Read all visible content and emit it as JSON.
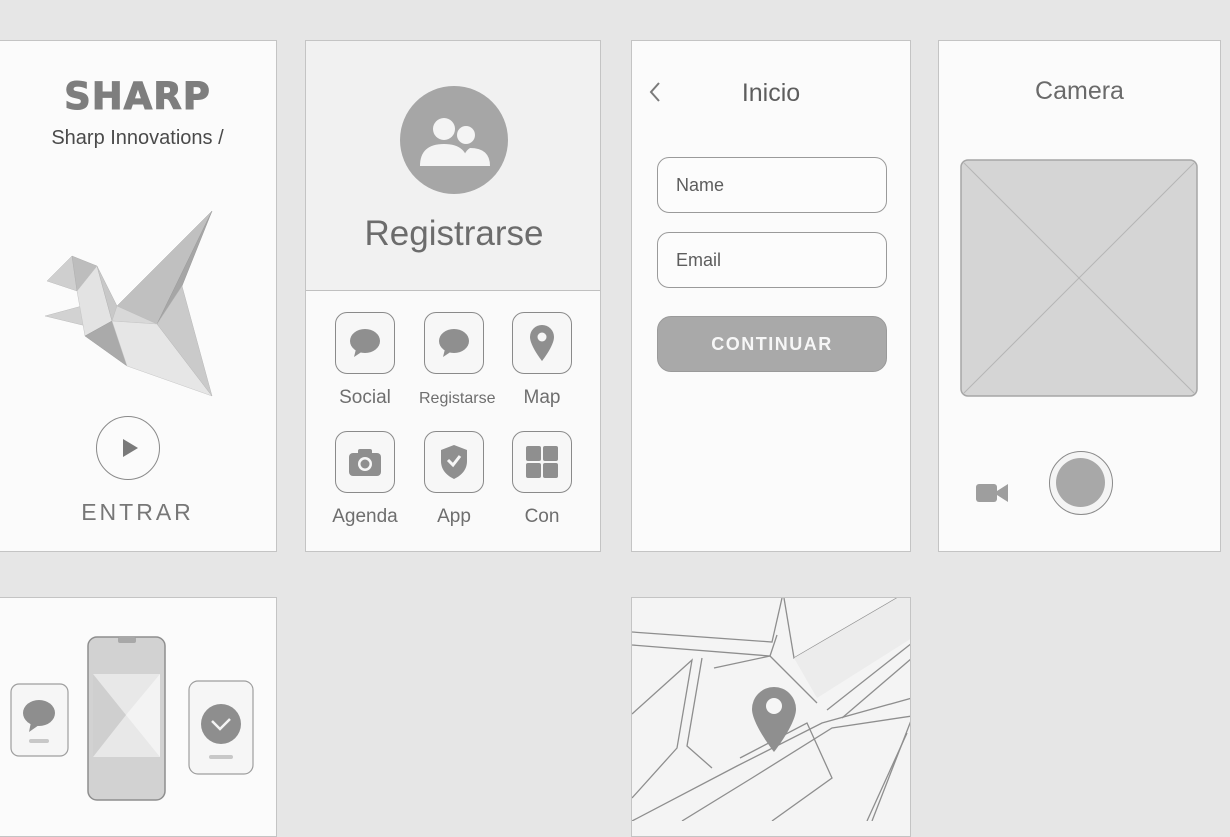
{
  "splash": {
    "brand": "SHARP",
    "tagline": "Sharp Innovations /",
    "enter_label": "ENTRAR"
  },
  "register": {
    "title": "Registrarse",
    "apps": [
      {
        "label": "Social",
        "icon": "chat-bubble-icon"
      },
      {
        "label": "Registarse",
        "icon": "chat-bubble-icon"
      },
      {
        "label": "Map",
        "icon": "map-pin-icon"
      },
      {
        "label": "Agenda",
        "icon": "camera-icon"
      },
      {
        "label": "App",
        "icon": "shield-check-icon"
      },
      {
        "label": "Con",
        "icon": "grid-icon"
      }
    ]
  },
  "login": {
    "title": "Inicio",
    "name_placeholder": "Name",
    "email_placeholder": "Email",
    "continue_label": "CONTINUAR"
  },
  "camera": {
    "title": "Camera"
  },
  "colors": {
    "background": "#e6e6e6",
    "panel": "#fbfbfb",
    "icon_gray": "#9e9e9e",
    "button_gray": "#a8a8a8"
  }
}
